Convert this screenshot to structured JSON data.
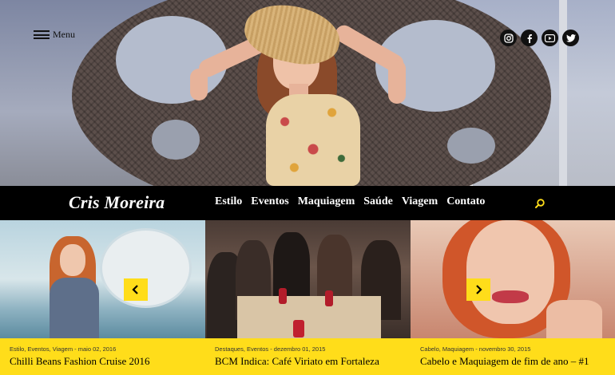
{
  "header": {
    "menu_label": "Menu",
    "social": [
      {
        "name": "instagram-icon",
        "glyph": "◎"
      },
      {
        "name": "facebook-icon",
        "glyph": "f"
      },
      {
        "name": "youtube-icon",
        "glyph": "▶"
      },
      {
        "name": "twitter-icon",
        "glyph": "✦"
      }
    ]
  },
  "nav": {
    "brand": "Cris Moreira",
    "links": [
      "Estilo",
      "Eventos",
      "Maquiagem",
      "Saúde",
      "Viagem",
      "Contato"
    ]
  },
  "posts": [
    {
      "meta": "Estilo, Eventos, Viagem - maio 02, 2016",
      "title": "Chilli Beans Fashion Cruise 2016"
    },
    {
      "meta": "Destaques, Eventos - dezembro 01, 2015",
      "title": "BCM Indica: Café Viriato em Fortaleza"
    },
    {
      "meta": "Cabelo, Maquiagem - novembro 30, 2015",
      "title": "Cabelo e Maquiagem de fim de ano – #1"
    }
  ],
  "slider": {
    "prev_glyph": "‹",
    "next_glyph": "›"
  },
  "colors": {
    "accent": "#ffdd1a",
    "navbar": "#000000"
  }
}
